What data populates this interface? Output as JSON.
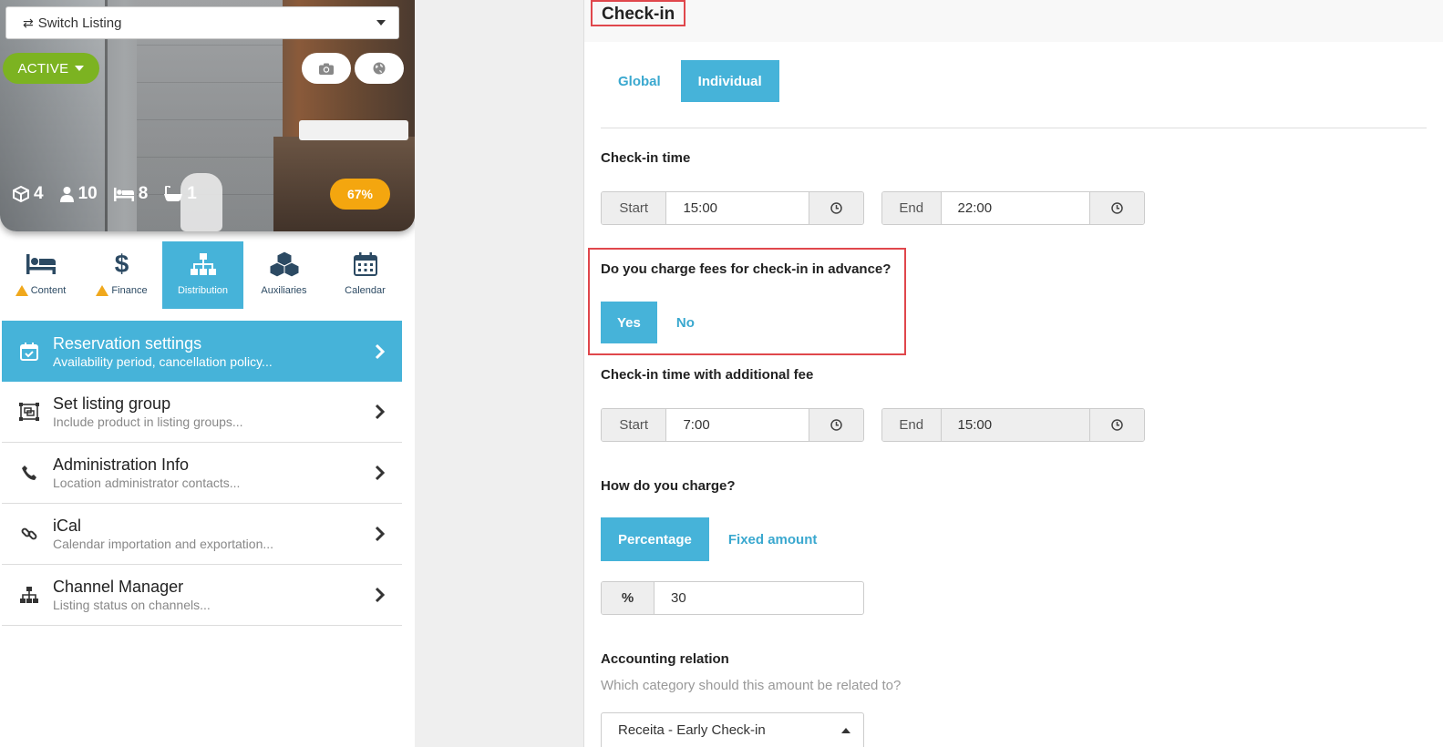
{
  "listing": {
    "switch_label": "Switch Listing",
    "status": "ACTIVE",
    "progress": "67%",
    "stats": [
      {
        "icon": "cube-icon",
        "value": "4"
      },
      {
        "icon": "person-icon",
        "value": "10"
      },
      {
        "icon": "bed-icon",
        "value": "8"
      },
      {
        "icon": "bathtub-icon",
        "value": "1"
      }
    ]
  },
  "tabs": [
    {
      "label": "Content",
      "icon": "bed-icon",
      "warning": true
    },
    {
      "label": "Finance",
      "icon": "dollar-icon",
      "warning": true
    },
    {
      "label": "Distribution",
      "icon": "sitemap-icon",
      "warning": false,
      "active": true
    },
    {
      "label": "Auxiliaries",
      "icon": "cubes-icon",
      "warning": false
    },
    {
      "label": "Calendar",
      "icon": "calendar-icon",
      "warning": false
    }
  ],
  "menu": [
    {
      "title": "Reservation settings",
      "subtitle": "Availability period, cancellation policy...",
      "icon": "calendar-check-icon",
      "active": true
    },
    {
      "title": "Set listing group",
      "subtitle": "Include product in listing groups...",
      "icon": "object-group-icon"
    },
    {
      "title": "Administration Info",
      "subtitle": "Location administrator contacts...",
      "icon": "phone-icon"
    },
    {
      "title": "iCal",
      "subtitle": "Calendar importation and exportation...",
      "icon": "link-icon"
    },
    {
      "title": "Channel Manager",
      "subtitle": "Listing status on channels...",
      "icon": "sitemap-icon"
    }
  ],
  "checkin": {
    "title": "Check-in",
    "scope_options": [
      "Global",
      "Individual"
    ],
    "scope_selected": "Individual",
    "time_label": "Check-in time",
    "start_label": "Start",
    "end_label": "End",
    "start_time": "15:00",
    "end_time": "22:00",
    "advance_fee_question": "Do you charge fees for check-in in advance?",
    "yes_label": "Yes",
    "no_label": "No",
    "advance_fee_selected": "Yes",
    "fee_time_label": "Check-in time with additional fee",
    "fee_start_time": "7:00",
    "fee_end_time": "15:00",
    "charge_question": "How do you charge?",
    "charge_options": [
      "Percentage",
      "Fixed amount"
    ],
    "charge_selected": "Percentage",
    "percent_symbol": "%",
    "percent_value": "30",
    "accounting_label": "Accounting relation",
    "accounting_hint": "Which category should this amount be related to?",
    "accounting_value": "Receita - Early Check-in"
  },
  "colors": {
    "accent": "#46b3d9",
    "active_status": "#7cb321",
    "progress": "#f4a60f",
    "highlight_border": "#e0474c",
    "warning": "#f0a81c"
  }
}
